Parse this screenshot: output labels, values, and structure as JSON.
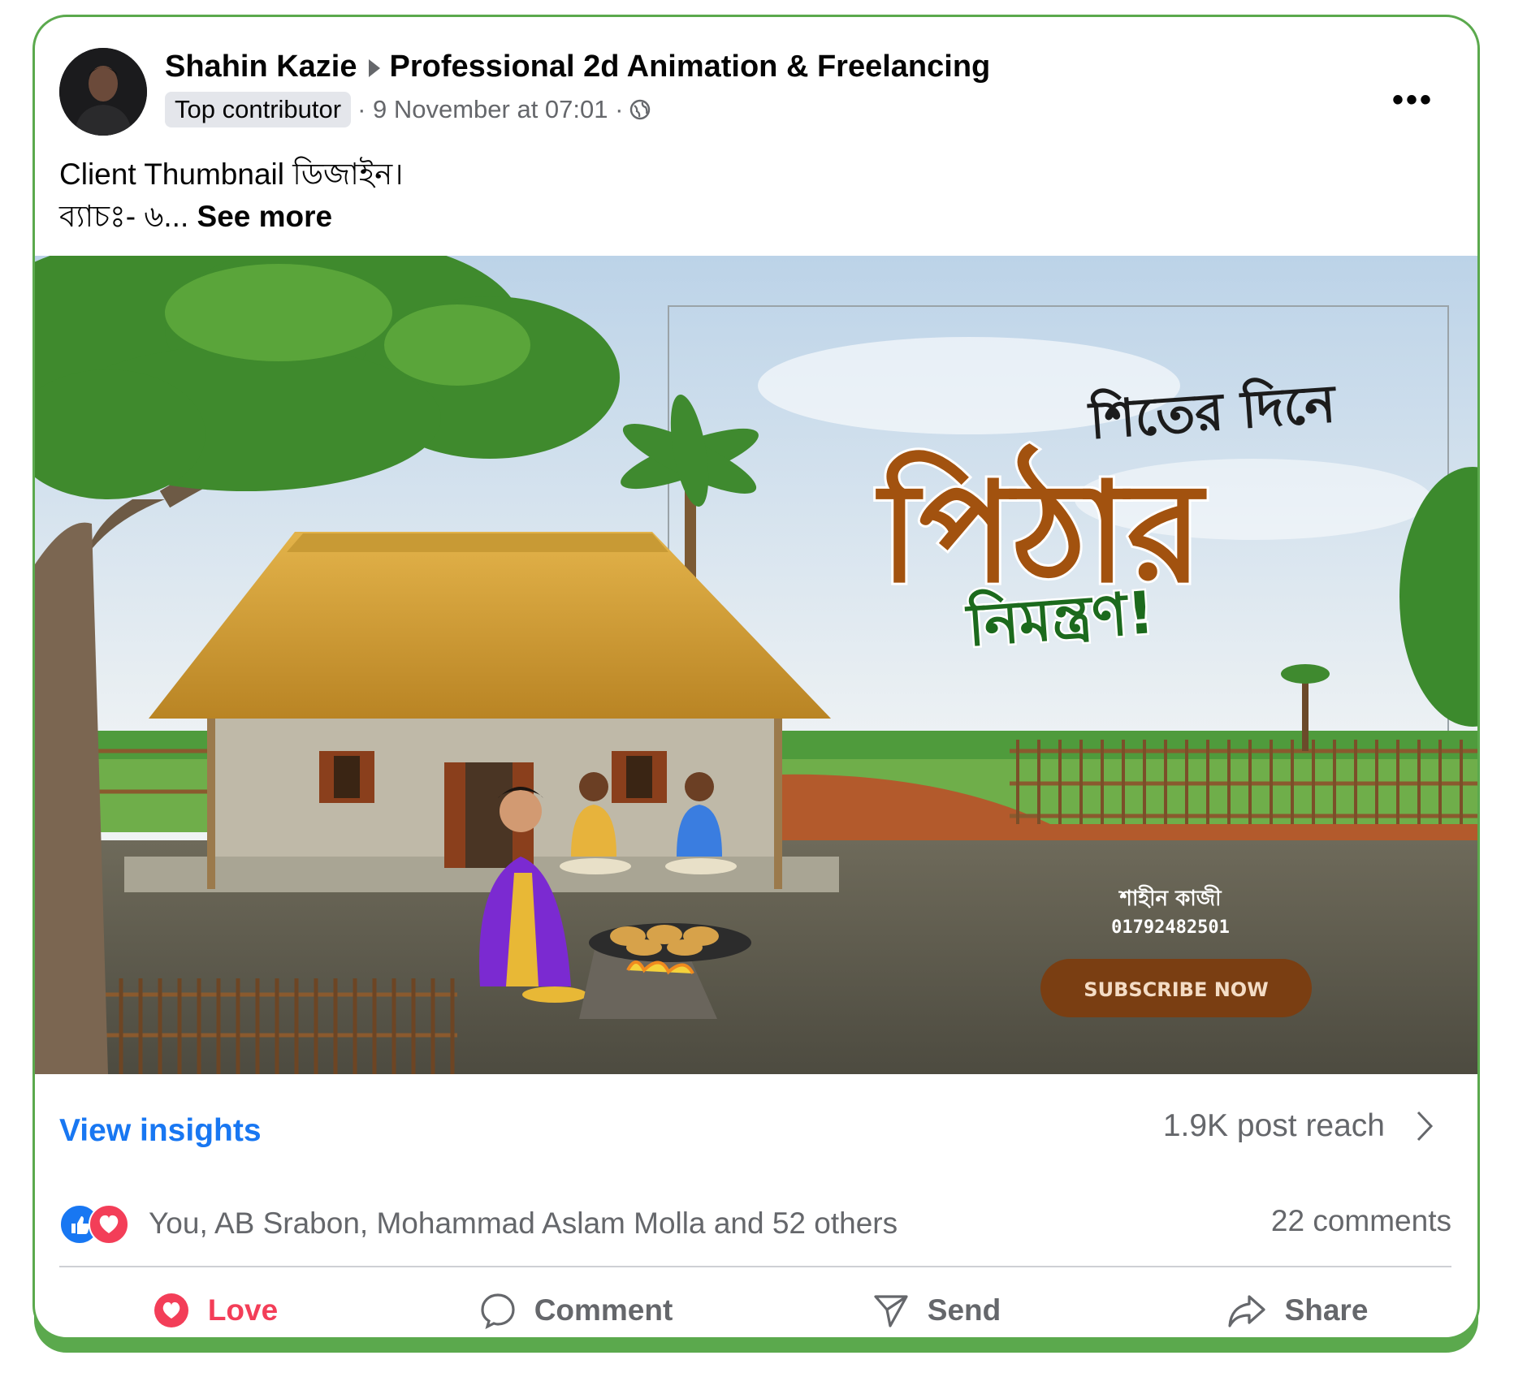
{
  "post": {
    "author": "Shahin Kazie",
    "group": "Professional 2d Animation & Freelancing",
    "badge": "Top contributor",
    "timestamp": "· 9 November at 07:01 ·",
    "caption_line1": "Client Thumbnail ডিজাইন।",
    "caption_line2": "ব্যাচঃ- ৬...",
    "see_more": "See more"
  },
  "thumbnail": {
    "headline_small": "শিতের দিনে",
    "headline_big": "পিঠার",
    "headline_green": "নিমন্ত্রণ!",
    "author_name": "শাহীন কাজী",
    "phone": "01792482501",
    "subscribe": "SUBSCRIBE NOW"
  },
  "insights": {
    "view_label": "View insights",
    "reach": "1.9K post reach"
  },
  "reactions": {
    "summary": "You, AB Srabon, Mohammad Aslam Molla and 52 others",
    "comments": "22 comments"
  },
  "actions": {
    "love": "Love",
    "comment": "Comment",
    "send": "Send",
    "share": "Share"
  },
  "colors": {
    "accent": "#1877f2",
    "love": "#f33e58",
    "frame": "#5ba94d",
    "title_brown": "#a2520f",
    "title_green": "#1c6a1d"
  },
  "icons": [
    "more-icon",
    "globe-icon",
    "chevron-right-icon",
    "like-icon",
    "love-icon",
    "comment-icon",
    "send-icon",
    "share-icon"
  ]
}
